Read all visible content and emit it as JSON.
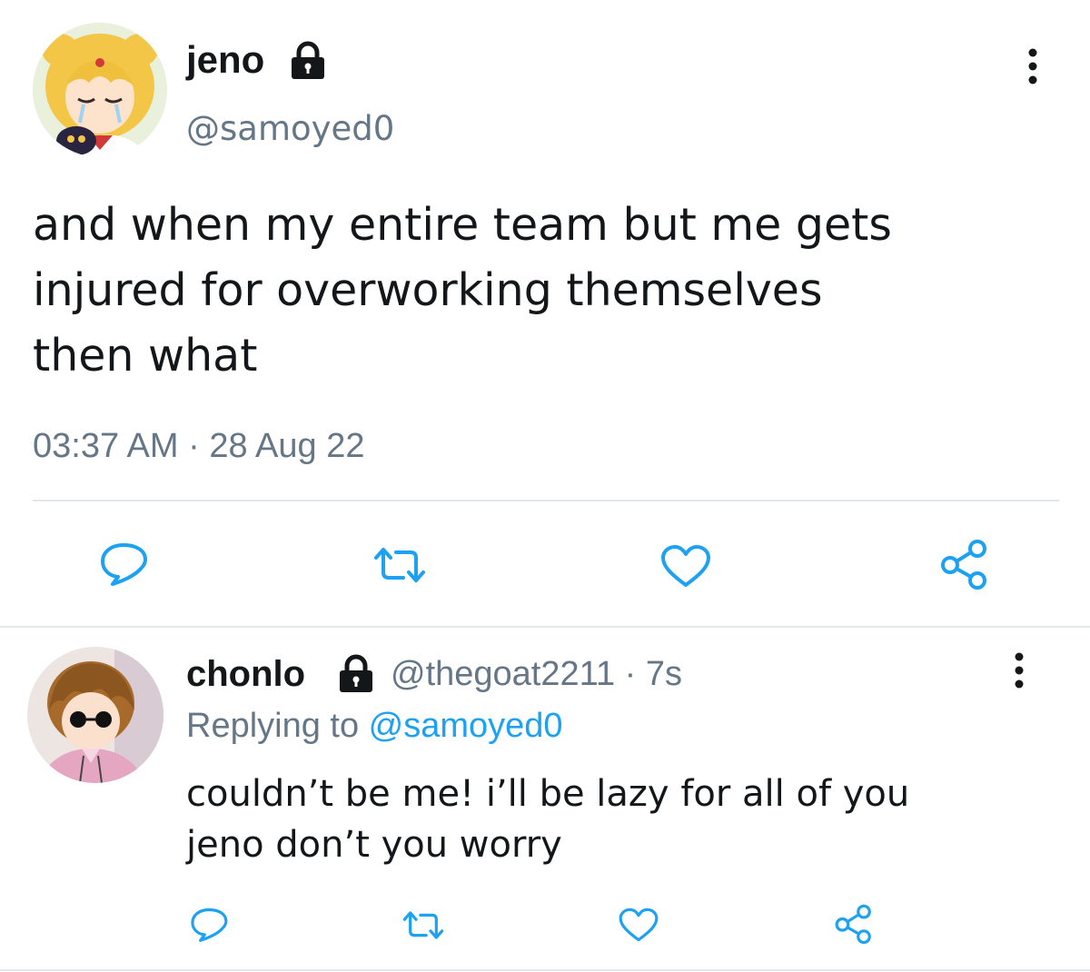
{
  "tweet": {
    "display_name": "jeno",
    "handle": "@samoyed0",
    "text_lines": [
      "and when my entire team but me gets",
      "injured for overworking themselves",
      "then what"
    ],
    "timestamp": "03:37 AM · 28 Aug 22",
    "avatar_icon": "sailor-moon-avatar",
    "actions": [
      "reply-icon",
      "retweet-icon",
      "like-icon",
      "share-icon"
    ]
  },
  "reply": {
    "display_name": "chonlo",
    "handle": "@thegoat2211",
    "separator": " · ",
    "time": "7s",
    "replying_prefix": "Replying to ",
    "replying_to": "@samoyed0",
    "text_lines": [
      "couldn’t be me! i’ll be lazy for all of you",
      "jeno don’t you worry"
    ],
    "avatar_icon": "anime-character-avatar",
    "actions": [
      "reply-icon",
      "retweet-icon",
      "like-icon",
      "share-icon"
    ]
  },
  "colors": {
    "text": "#14171a",
    "secondary": "#657786",
    "link": "#1da1f2",
    "divider": "#e1e8ed",
    "icon": "#1da1f2"
  }
}
